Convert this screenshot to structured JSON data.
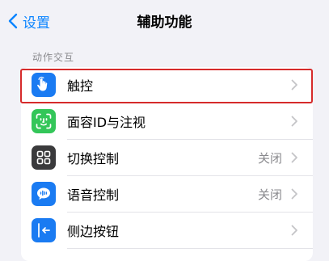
{
  "nav": {
    "back_label": "设置",
    "title": "辅助功能"
  },
  "section": {
    "header": "动作交互"
  },
  "rows": [
    {
      "label": "触控",
      "value": "",
      "icon": "hand-pointer-icon",
      "icon_color": "#1a7bf2"
    },
    {
      "label": "面容ID与注视",
      "value": "",
      "icon": "face-id-icon",
      "icon_color": "#33c659"
    },
    {
      "label": "切换控制",
      "value": "关闭",
      "icon": "switch-control-icon",
      "icon_color": "#3a3a3c"
    },
    {
      "label": "语音控制",
      "value": "关闭",
      "icon": "voice-control-icon",
      "icon_color": "#1a7bf2"
    },
    {
      "label": "侧边按钮",
      "value": "",
      "icon": "side-button-icon",
      "icon_color": "#1a7bf2"
    }
  ],
  "colors": {
    "accent": "#0a84ff",
    "highlight": "#d62b2b",
    "background": "#f2f2f7"
  }
}
